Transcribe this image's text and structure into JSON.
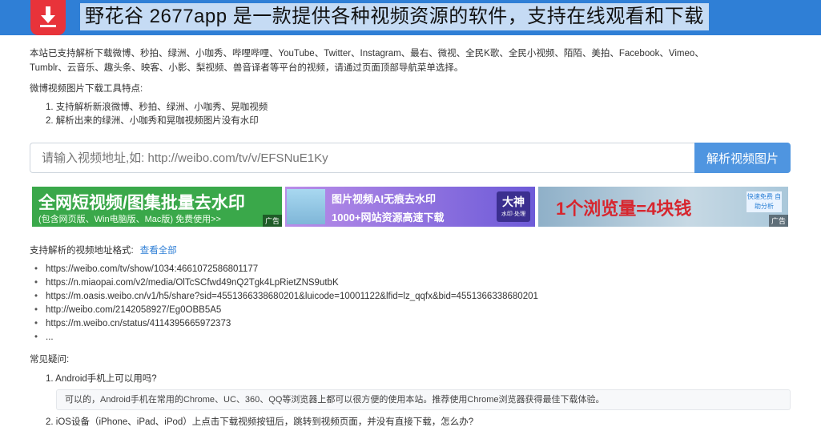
{
  "overlay_title": "野花谷 2677app 是一款提供各种视频资源的软件，支持在线观看和下载",
  "intro": {
    "line1": "本站已支持解析下载微博、秒拍、绿洲、小咖秀、哔哩哔哩、YouTube、Twitter、Instagram、最右、微视、全民K歌、全民小视频、陌陌、美拍、Facebook、Vimeo、",
    "line2": "Tumblr、云音乐、趣头条、映客、小影、梨视频、兽音译者等平台的视频，请通过页面顶部导航菜单选择。"
  },
  "features": {
    "title": "微博视频图片下载工具特点:",
    "items": [
      "1. 支持解析新浪微博、秒拍、绿洲、小咖秀、晃咖视频",
      "2. 解析出来的绿洲、小咖秀和晃咖视频图片没有水印"
    ]
  },
  "search": {
    "placeholder": "请输入视频地址,如: http://weibo.com/tv/v/EFSNuE1Ky",
    "button": "解析视频图片"
  },
  "banners": {
    "b1_main": "全网短视频/图集批量去水印",
    "b1_sub": "(包含网页版、Win电脑版、Mac版) 免费使用>>",
    "b2_main": "图片视频AI无痕去水印",
    "b2_sub": "1000+网站资源高速下载",
    "b2_badge": "大神",
    "b2_badge_sub": "水印·处理",
    "b3_main": "1个浏览量=4块钱",
    "b3_cta": "快速免费 自助分析",
    "ad_label": "广告"
  },
  "formats": {
    "title": "支持解析的视频地址格式:",
    "view_all": "查看全部",
    "urls": [
      "https://weibo.com/tv/show/1034:4661072586801177",
      "https://n.miaopai.com/v2/media/OlTcSCfwd49nQ2Tgk4LpRietZNS9utbK",
      "https://m.oasis.weibo.cn/v1/h5/share?sid=4551366338680201&luicode=10001122&lfid=lz_qqfx&bid=4551366338680201",
      "http://weibo.com/2142058927/Eg0OBB5A5",
      "https://m.weibo.cn/status/4114395665972373",
      "..."
    ]
  },
  "faq": {
    "title": "常见疑问:",
    "q1": "1. Android手机上可以用吗?",
    "a1": "可以的，Android手机在常用的Chrome、UC、360、QQ等浏览器上都可以很方便的使用本站。推荐使用Chrome浏览器获得最佳下载体验。",
    "q2": "2. iOS设备（iPhone、iPad、iPod）上点击下载视频按钮后，跳转到视频页面，并没有直接下载，怎么办?"
  },
  "colors": {
    "topbar": "#2f7fd6",
    "button": "#4f95e0",
    "app_icon": "#e8333a"
  },
  "icons": {
    "app": "download-arrow-icon"
  }
}
